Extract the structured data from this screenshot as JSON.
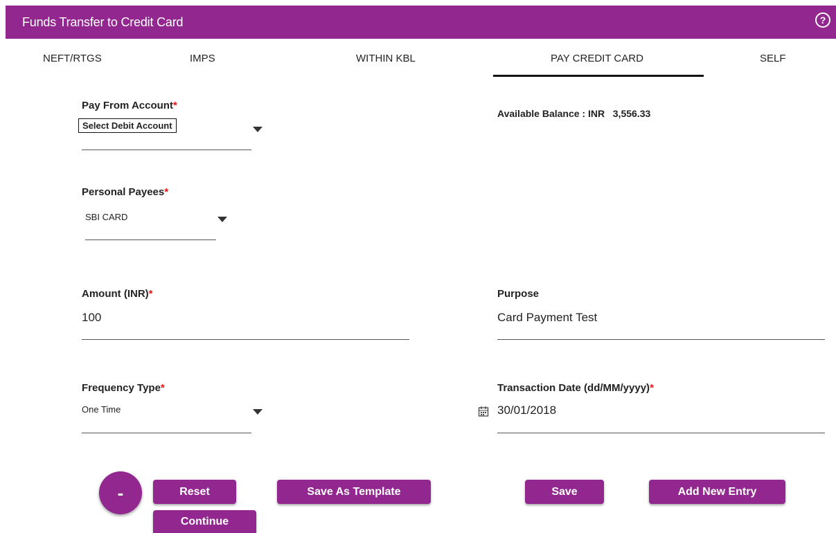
{
  "header": {
    "title": "Funds Transfer to Credit Card",
    "help_icon": "question-circle-icon",
    "bg_color": "#92278f"
  },
  "tabs": [
    {
      "label": "NEFT/RTGS",
      "active": false
    },
    {
      "label": "IMPS",
      "active": false
    },
    {
      "label": "WITHIN KBL",
      "active": false
    },
    {
      "label": "PAY CREDIT CARD",
      "active": true
    },
    {
      "label": "SELF",
      "active": false
    }
  ],
  "form": {
    "pay_from": {
      "label": "Pay From Account",
      "required": "*",
      "selected": "Select Debit Account"
    },
    "balance": {
      "label": "Available Balance : INR",
      "value": "3,556.33"
    },
    "payees": {
      "label": "Personal Payees",
      "required": "*",
      "selected": "SBI CARD"
    },
    "amount": {
      "label": "Amount (INR)",
      "required": "*",
      "value": "100"
    },
    "purpose": {
      "label": "Purpose",
      "value": "Card Payment Test"
    },
    "frequency": {
      "label": "Frequency Type",
      "required": "*",
      "selected": "One Time"
    },
    "txn_date": {
      "label": "Transaction Date (dd/MM/yyyy)",
      "required": "*",
      "value": "30/01/2018",
      "icon": "calendar-icon"
    }
  },
  "buttons": {
    "collapse": "-",
    "reset": "Reset",
    "continue": "Continue",
    "save_template": "Save As Template",
    "save": "Save",
    "add_entry": "Add New Entry"
  }
}
